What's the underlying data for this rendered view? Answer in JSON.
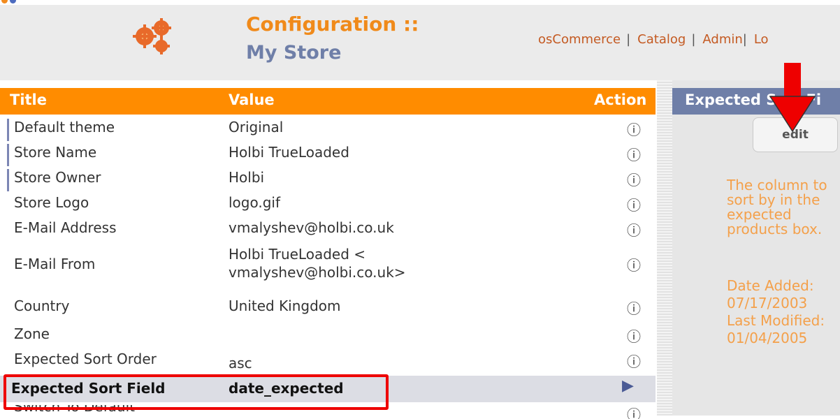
{
  "header": {
    "title_line1": "Configuration ::",
    "title_line2": "My Store",
    "nav": [
      "osCommerce",
      "Catalog",
      "Admin",
      "Lo"
    ],
    "nav_separator": "|"
  },
  "table": {
    "columns": {
      "title": "Title",
      "value": "Value",
      "action": "Action"
    },
    "rows": [
      {
        "title": "Default theme",
        "value": "Original"
      },
      {
        "title": "Store Name",
        "value": "Holbi TrueLoaded"
      },
      {
        "title": "Store Owner",
        "value": "Holbi"
      },
      {
        "title": "Store Logo",
        "value": "logo.gif"
      },
      {
        "title": "E-Mail Address",
        "value": "vmalyshev@holbi.co.uk"
      },
      {
        "title": "E-Mail From",
        "value_line1": "Holbi TrueLoaded <",
        "value_line2": "vmalyshev@holbi.co.uk>"
      },
      {
        "title": "Country",
        "value": "United Kingdom"
      },
      {
        "title": "Zone",
        "value": ""
      },
      {
        "title": "Expected Sort Order",
        "value": "asc"
      },
      {
        "title": "Expected Sort Field",
        "value": "date_expected",
        "selected": true
      },
      {
        "title": "Switch To Default",
        "value": ""
      }
    ]
  },
  "panel": {
    "heading": "Expected Sort Fi",
    "edit_label": "edit",
    "description": "The column to sort by in the expected products box.",
    "date_added_label": "Date Added:",
    "date_added": "07/17/2003",
    "last_modified_label": "Last Modified:",
    "last_modified": "01/04/2005"
  },
  "icons": {
    "info": "info-icon",
    "selected": "arrow-right-icon",
    "annotation": "red-arrow-icon"
  },
  "colors": {
    "accent": "#ff8c00",
    "panel_header": "#6f7fa8",
    "annotation": "#ee0000"
  }
}
